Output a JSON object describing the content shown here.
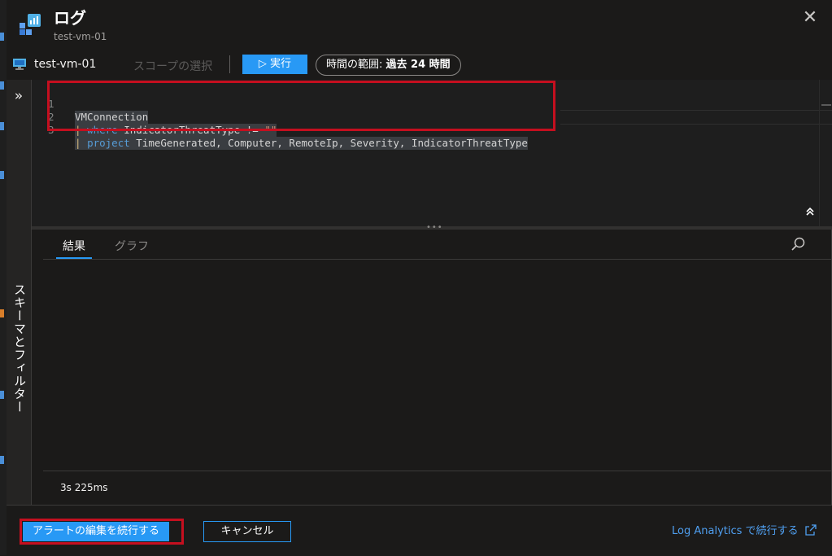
{
  "header": {
    "title": "ログ",
    "subtitle": "test-vm-01",
    "close_glyph": "✕"
  },
  "toolbar": {
    "vm_name": "test-vm-01",
    "scope_label": "スコープの選択",
    "run_label": "▷ 実行",
    "time_range_label": "時間の範囲:",
    "time_range_value": "過去 24 時間"
  },
  "schema_panel": {
    "label": "スキーマとフィルター",
    "expand_glyph": "»"
  },
  "editor": {
    "lines": [
      {
        "number": "1",
        "text": "VMConnection"
      },
      {
        "number": "2",
        "text": "| where IndicatorThreatType != \"\""
      },
      {
        "number": "3",
        "text": "| project TimeGenerated, Computer, RemoteIp, Severity, IndicatorThreatType"
      }
    ],
    "collapse_glyph": "⌃"
  },
  "results": {
    "tabs": [
      "結果",
      "グラフ"
    ],
    "duration": "3s 225ms"
  },
  "footer": {
    "continue_label": "アラートの編集を続行する",
    "cancel_label": "キャンセル",
    "log_analytics_link": "Log Analytics で続行する"
  },
  "colors": {
    "accent": "#2899f5",
    "highlight_box": "#c50f1f",
    "background": "#1b1a19",
    "keyword": "#569cd6",
    "string": "#ce9178"
  },
  "icons": [
    "log-analytics-logo-icon",
    "close-icon",
    "vm-icon",
    "expand-icon",
    "collapse-icon",
    "search-icon",
    "external-link-icon"
  ]
}
